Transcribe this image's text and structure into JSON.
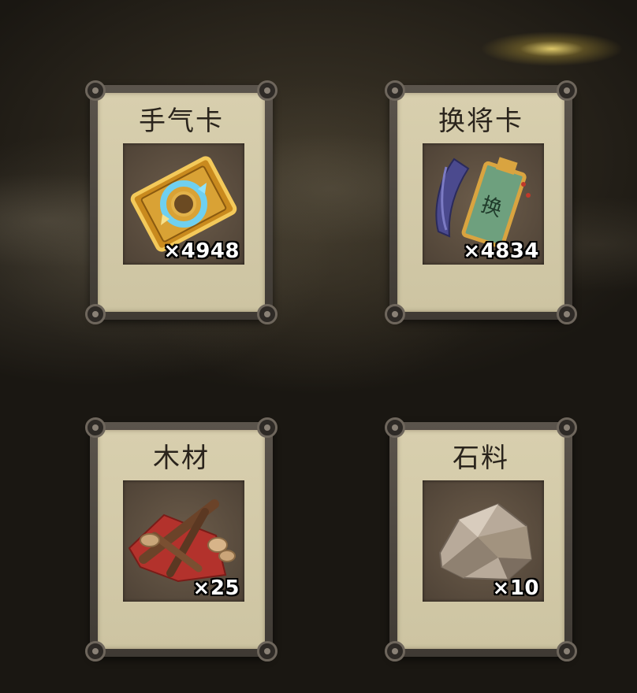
{
  "items": [
    {
      "name": "手气卡",
      "count": "×4948",
      "icon": "luck-card-icon"
    },
    {
      "name": "换将卡",
      "count": "×4834",
      "icon": "swap-general-card-icon",
      "icon_glyph": "换"
    },
    {
      "name": "木材",
      "count": "×25",
      "icon": "wood-icon"
    },
    {
      "name": "石料",
      "count": "×10",
      "icon": "stone-icon"
    }
  ]
}
